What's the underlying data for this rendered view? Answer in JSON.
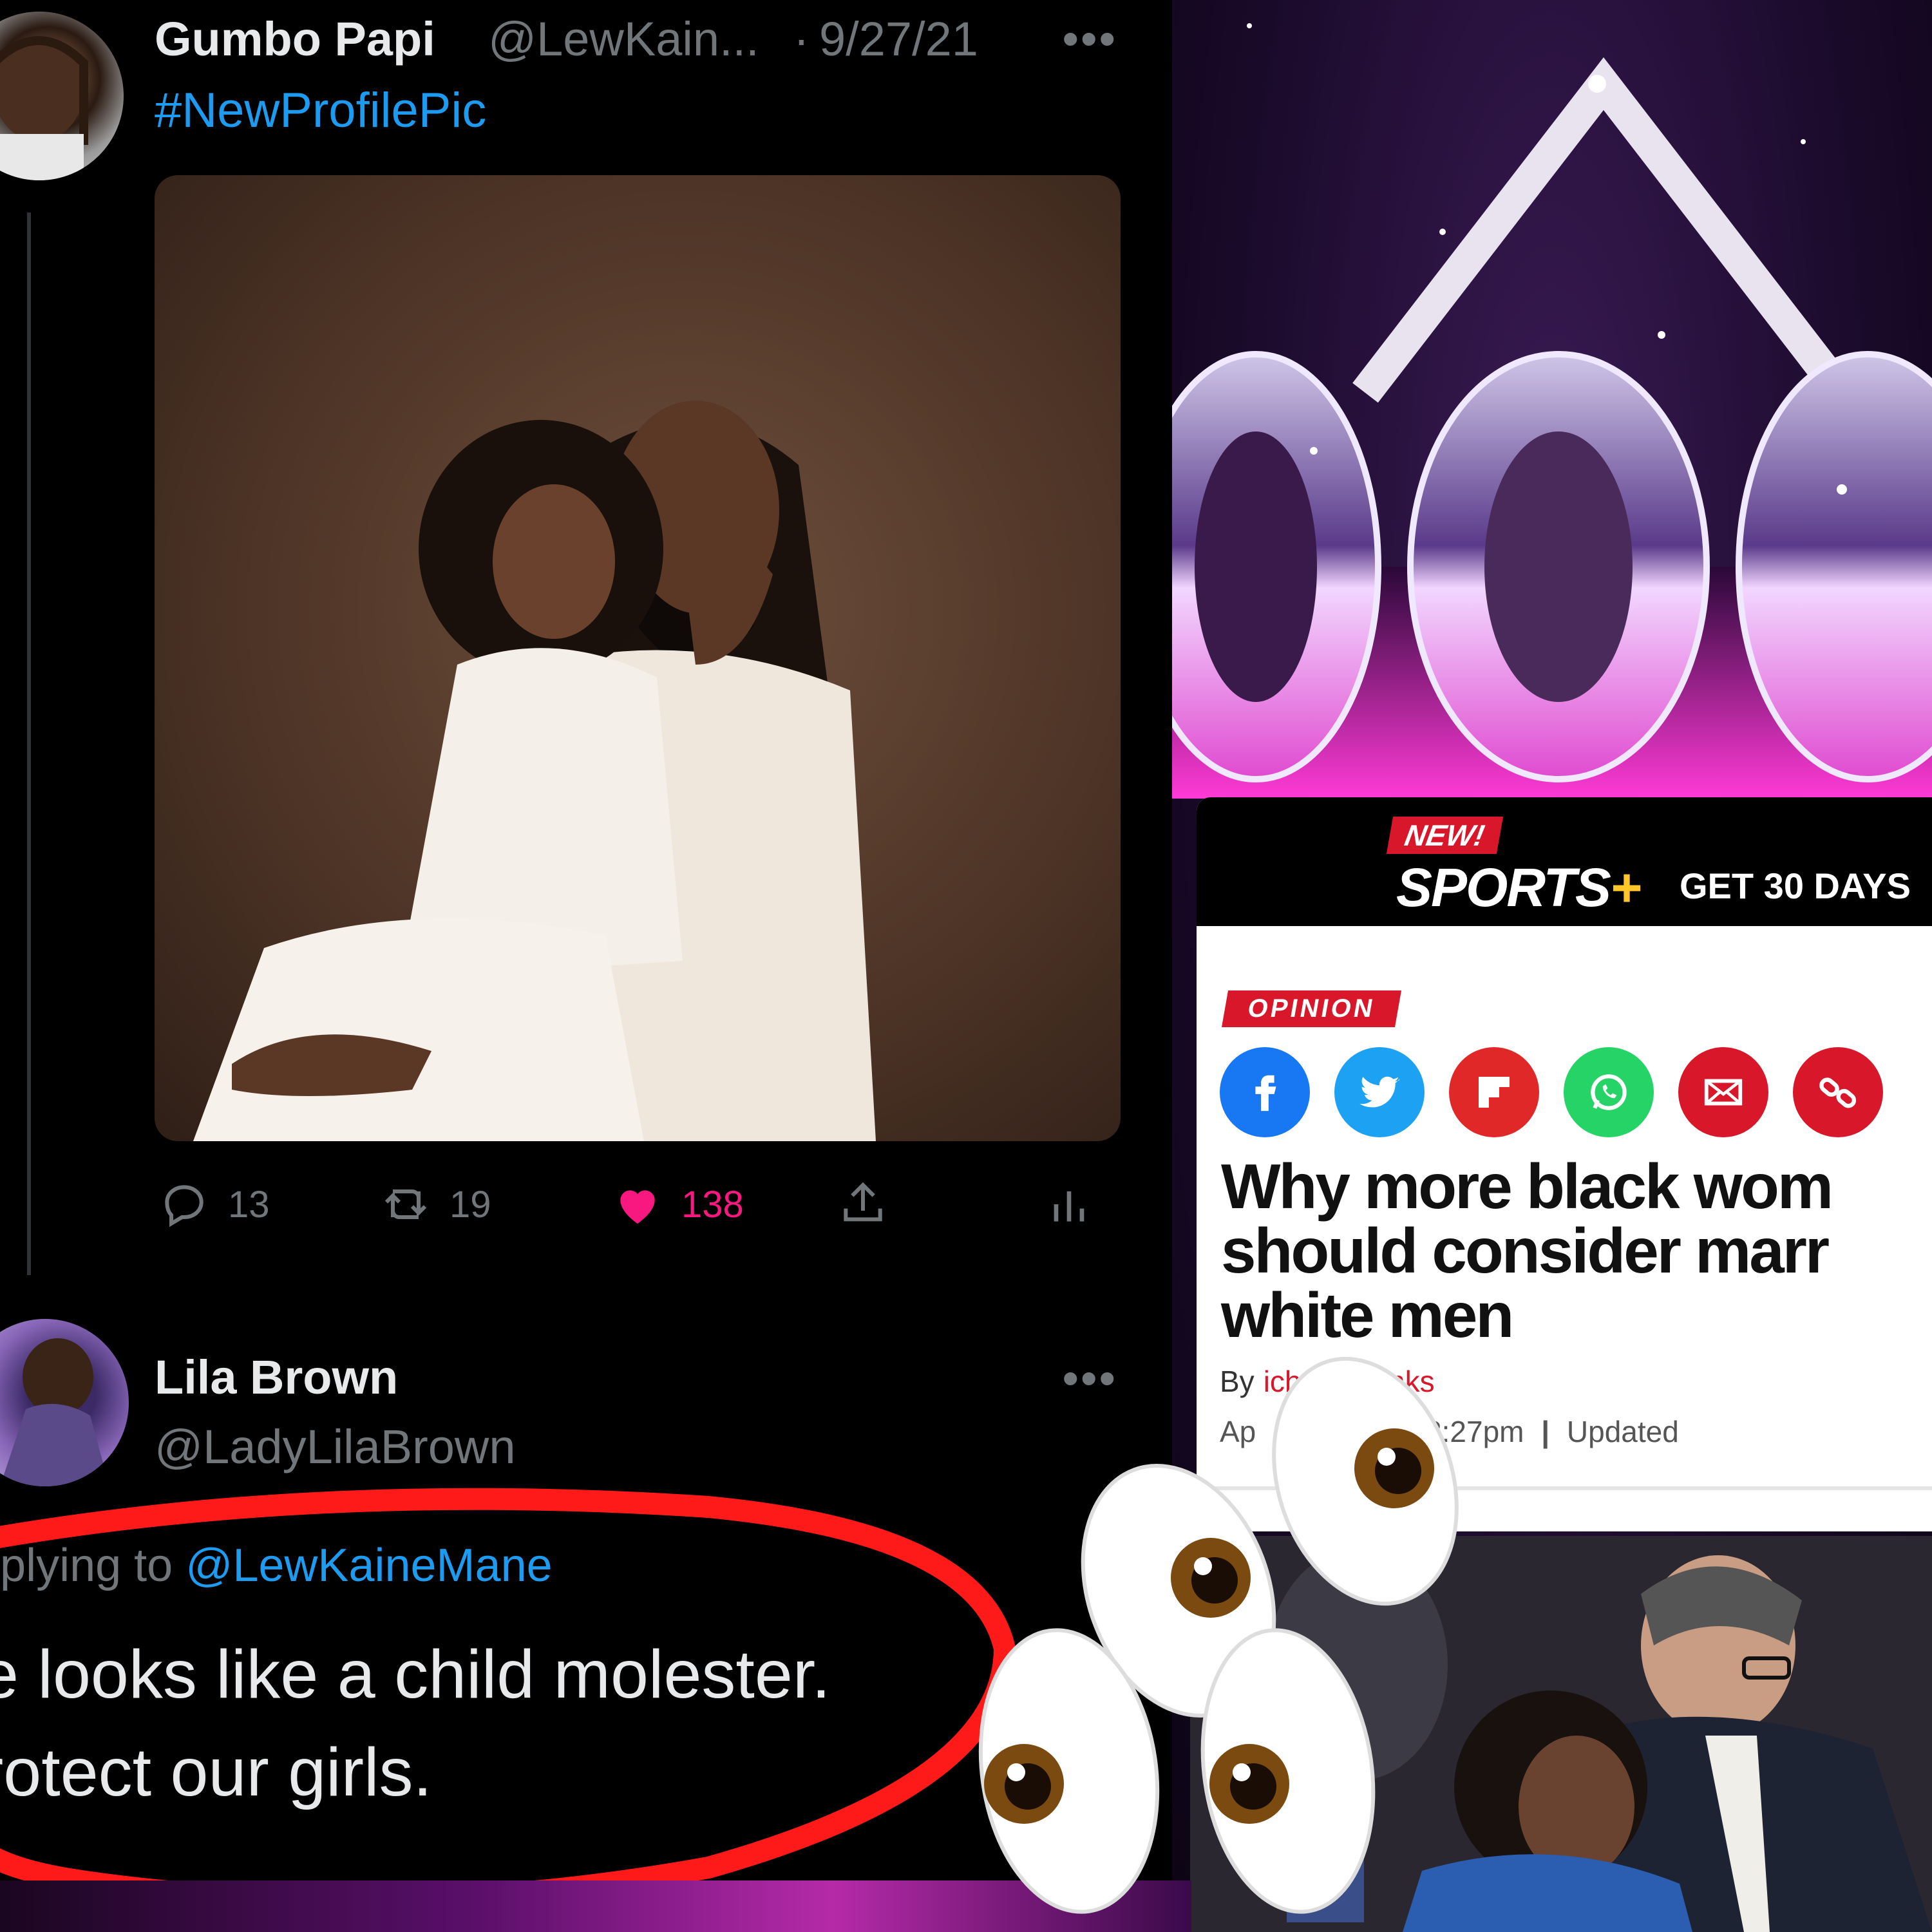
{
  "tweet": {
    "author_name": "Gumbo Papi",
    "author_handle": "@LewKain...",
    "separator": "·",
    "date": "9/27/21",
    "more": "•••",
    "text": "#NewProfilePic",
    "stats": {
      "replies": "13",
      "retweets": "19",
      "likes": "138"
    },
    "icons": [
      "reply-icon",
      "retweet-icon",
      "heart-icon",
      "share-icon",
      "analytics-icon"
    ]
  },
  "reply": {
    "author_name": "Lila Brown",
    "author_handle": "@LadyLilaBrown",
    "more": "•••",
    "replying_prefix": "eplying to",
    "replying_to": "@LewKaineMane",
    "line1": "e looks like a child molester.",
    "line2": "rotect our girls."
  },
  "article": {
    "badge_new": "NEW!",
    "brand": "SPORTS",
    "brand_plus": "+",
    "promo": "GET 30 DAYS",
    "section": "OPINION",
    "share_icons": [
      "facebook-icon",
      "twitter-icon",
      "flipboard-icon",
      "whatsapp-icon",
      "email-icon",
      "link-icon"
    ],
    "title_line1": "Why more black wom",
    "title_line2": "should consider marr",
    "title_line3": "white men",
    "byline_prefix": "By",
    "author": "ichard Banks",
    "date_prefix": "Ap",
    "time": "8:27pm",
    "date_sep": "|",
    "updated": "Updated"
  },
  "colors": {
    "background": "#000000",
    "link_blue": "#1d9bf0",
    "like_pink": "#f91880",
    "annotation_red": "#ff1a1a",
    "nypost_red": "#d8182a",
    "sports_plus_yellow": "#ffc629"
  },
  "decor": {
    "emoji": "eyes-emoji",
    "count": 4
  }
}
